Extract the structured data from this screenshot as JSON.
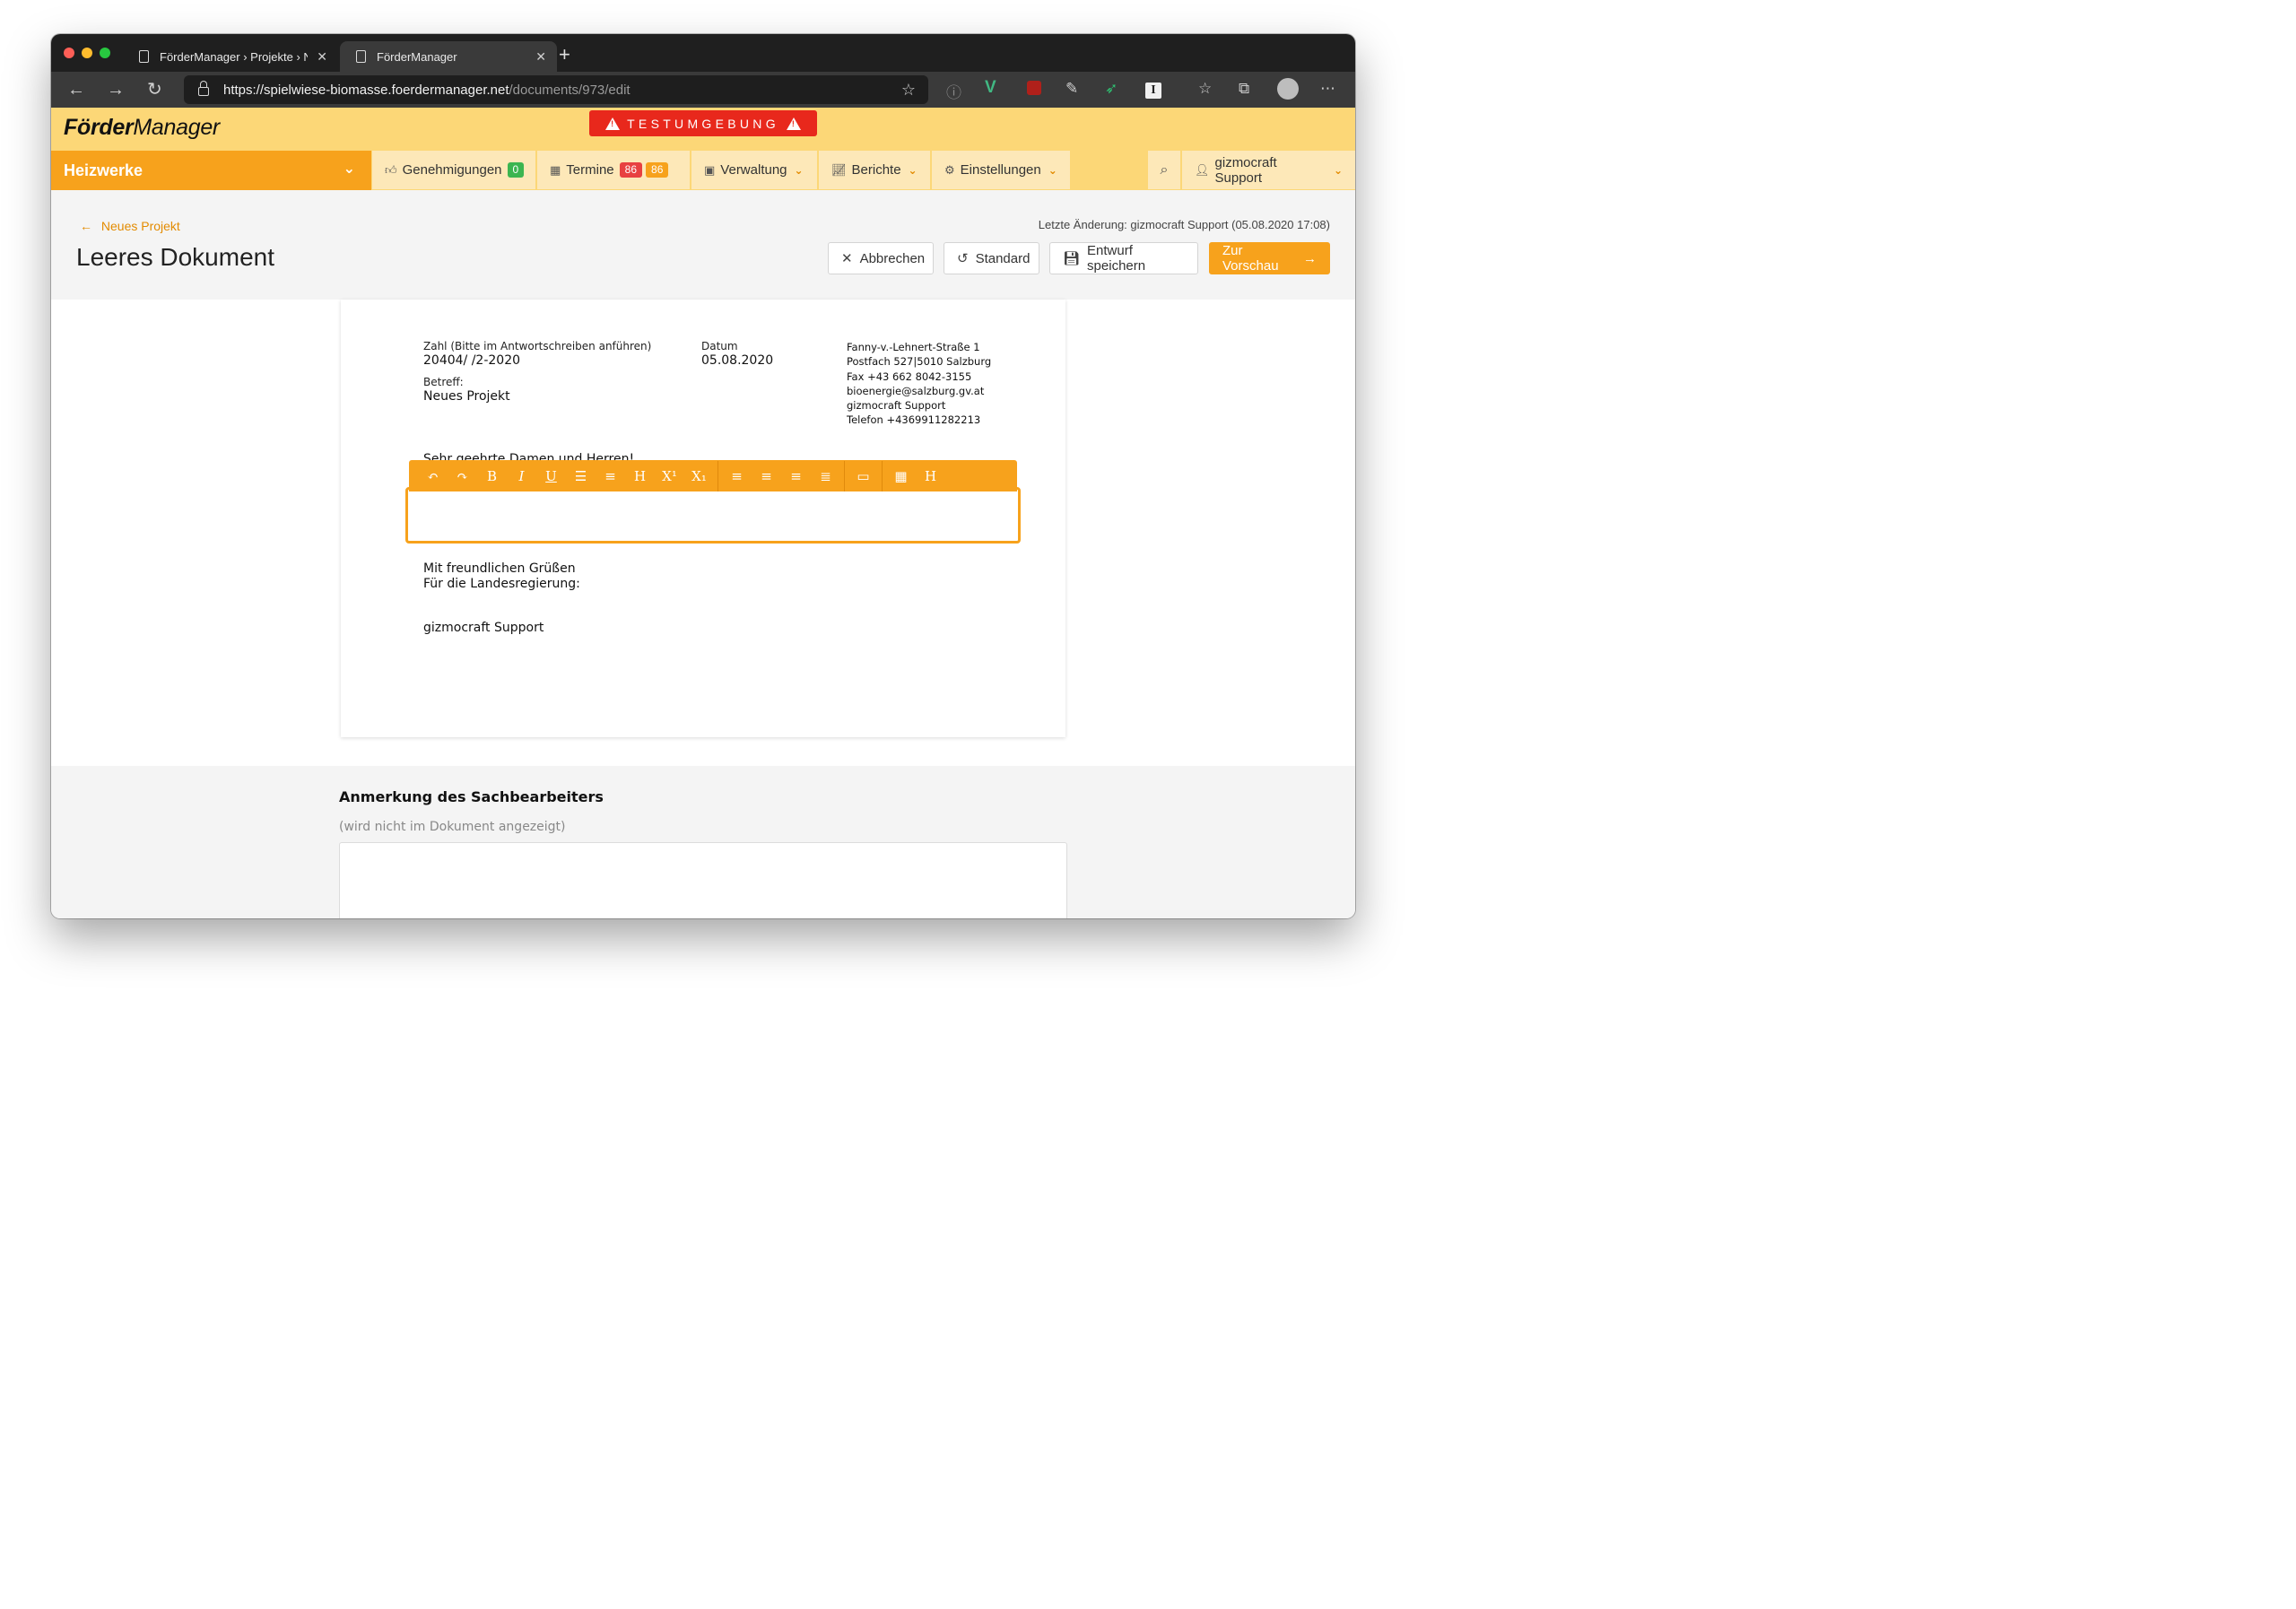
{
  "browser": {
    "tabs": [
      {
        "title": "FörderManager › Projekte › Ne",
        "active": false
      },
      {
        "title": "FörderManager",
        "active": true
      }
    ],
    "url_domain": "https://spielwiese-biomasse.foerdermanager.net",
    "url_path": "/documents/973/edit"
  },
  "app": {
    "logo_bold": "Förder",
    "logo_light": "Manager",
    "env_banner": "TESTUMGEBUNG",
    "nav": {
      "section": "Heizwerke",
      "approvals_label": "Genehmigungen",
      "approvals_count": "0",
      "appointments_label": "Termine",
      "appointments_count_red": "86",
      "appointments_count_orange": "86",
      "admin_label": "Verwaltung",
      "reports_label": "Berichte",
      "settings_label": "Einstellungen",
      "user_label": "gizmocraft Support"
    },
    "colors": {
      "accent": "#f7a21c",
      "header_bg": "#fcd777",
      "alert": "#e8281c",
      "success": "#3cb550"
    }
  },
  "page": {
    "back_link": "Neues Projekt",
    "last_change": "Letzte Änderung: gizmocraft Support (05.08.2020 17:08)",
    "title": "Leeres Dokument",
    "buttons": {
      "cancel": "Abbrechen",
      "default": "Standard",
      "save_draft": "Entwurf speichern",
      "preview": "Zur Vorschau"
    }
  },
  "document": {
    "ref_label": "Zahl (Bitte im Antwortschreiben anführen)",
    "ref_value": "20404/ /2-2020",
    "subject_label": "Betreff:",
    "subject_value": "Neues Projekt",
    "date_label": "Datum",
    "date_value": "05.08.2020",
    "address": [
      "Fanny-v.-Lehnert-Straße 1",
      "Postfach 527|5010 Salzburg",
      "Fax +43 662 8042-3155",
      "bioenergie@salzburg.gv.at",
      "gizmocraft Support",
      "Telefon +4369911282213"
    ],
    "salutation_partial": "Sehr geehrte Damen und Herren!",
    "closing_line1": "Mit freundlichen Grüßen",
    "closing_line2": "Für die Landesregierung:",
    "signature": "gizmocraft Support"
  },
  "editor_toolbar": [
    "undo-icon",
    "redo-icon",
    "bold-icon",
    "italic-icon",
    "underline-icon",
    "bullet-list-icon",
    "numbered-list-icon",
    "heading-icon",
    "superscript-icon",
    "subscript-icon",
    "align-left-icon",
    "align-center-icon",
    "align-right-icon",
    "align-justify-icon",
    "image-icon",
    "table-icon",
    "heading-alt-icon"
  ],
  "notes": {
    "title": "Anmerkung des Sachbearbeiters",
    "hint": "(wird nicht im Dokument angezeigt)"
  }
}
